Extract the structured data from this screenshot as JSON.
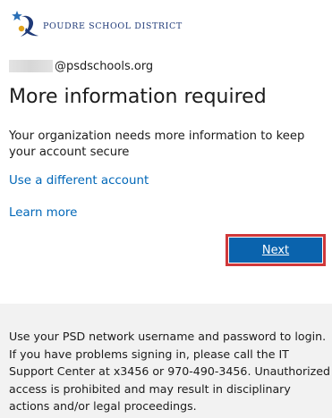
{
  "branding": {
    "org_name": "POUDRE SCHOOL DISTRICT",
    "logo_icon": "psd-star-swoosh-logo-icon"
  },
  "account": {
    "email_domain": "@psdschools.org"
  },
  "main": {
    "title": "More information required",
    "description": "Your organization needs more information to keep your account secure",
    "use_different_account": "Use a different account",
    "learn_more": "Learn more",
    "next_label": "Next"
  },
  "footer": {
    "notice": "Use your PSD network username and password to login. If you have problems signing in, please call the IT Support Center at x3456 or 970-490-3456. Unauthorized access is prohibited and may result in disciplinary actions and/or legal proceedings."
  },
  "colors": {
    "link": "#0067b8",
    "button_bg": "#0a63ad",
    "button_highlight_border": "#d0383a",
    "footer_bg": "#f2f2f2",
    "brand": "#1f3a78"
  }
}
